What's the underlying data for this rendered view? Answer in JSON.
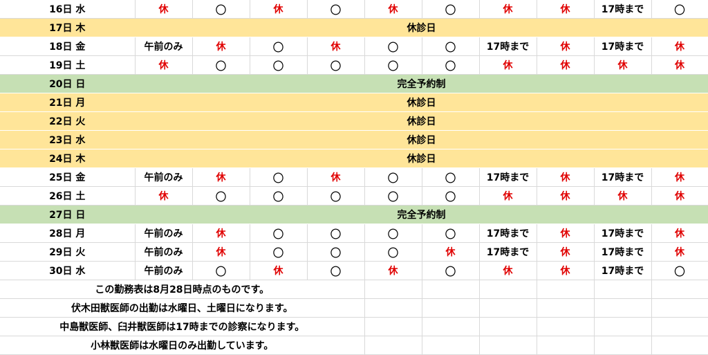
{
  "schedule": [
    {
      "date": "16日",
      "weekday": "水",
      "type": "normal",
      "cells": [
        "休",
        "〇",
        "休",
        "〇",
        "休",
        "〇",
        "休",
        "休",
        "17時まで",
        "〇"
      ]
    },
    {
      "date": "17日",
      "weekday": "木",
      "type": "holiday",
      "label": "休診日"
    },
    {
      "date": "18日",
      "weekday": "金",
      "type": "normal",
      "cells": [
        "午前のみ",
        "休",
        "〇",
        "休",
        "〇",
        "〇",
        "17時まで",
        "休",
        "17時まで",
        "休"
      ]
    },
    {
      "date": "19日",
      "weekday": "土",
      "type": "normal",
      "cells": [
        "休",
        "〇",
        "〇",
        "〇",
        "〇",
        "〇",
        "休",
        "休",
        "休",
        "休"
      ]
    },
    {
      "date": "20日",
      "weekday": "日",
      "type": "appointment",
      "label": "完全予約制"
    },
    {
      "date": "21日",
      "weekday": "月",
      "type": "holiday",
      "label": "休診日"
    },
    {
      "date": "22日",
      "weekday": "火",
      "type": "holiday",
      "label": "休診日"
    },
    {
      "date": "23日",
      "weekday": "水",
      "type": "holiday",
      "label": "休診日"
    },
    {
      "date": "24日",
      "weekday": "木",
      "type": "holiday",
      "label": "休診日"
    },
    {
      "date": "25日",
      "weekday": "金",
      "type": "normal",
      "cells": [
        "午前のみ",
        "休",
        "〇",
        "休",
        "〇",
        "〇",
        "17時まで",
        "休",
        "17時まで",
        "休"
      ]
    },
    {
      "date": "26日",
      "weekday": "土",
      "type": "normal",
      "cells": [
        "休",
        "〇",
        "〇",
        "〇",
        "〇",
        "〇",
        "休",
        "休",
        "休",
        "休"
      ]
    },
    {
      "date": "27日",
      "weekday": "日",
      "type": "appointment",
      "label": "完全予約制"
    },
    {
      "date": "28日",
      "weekday": "月",
      "type": "normal",
      "cells": [
        "午前のみ",
        "休",
        "〇",
        "〇",
        "〇",
        "〇",
        "17時まで",
        "休",
        "17時まで",
        "休"
      ]
    },
    {
      "date": "29日",
      "weekday": "火",
      "type": "normal",
      "cells": [
        "午前のみ",
        "休",
        "〇",
        "〇",
        "〇",
        "休",
        "17時まで",
        "休",
        "17時まで",
        "休"
      ]
    },
    {
      "date": "30日",
      "weekday": "水",
      "type": "normal",
      "cells": [
        "午前のみ",
        "〇",
        "休",
        "〇",
        "休",
        "〇",
        "休",
        "休",
        "17時まで",
        "〇"
      ]
    }
  ],
  "notes": [
    "この勤務表は8月28日時点のものです。",
    "伏木田獣医師の出勤は水曜日、土曜日になります。",
    "中島獣医師、臼井獣医師は17時までの診察になります。",
    "小林獣医師は水曜日のみ出勤しています。"
  ],
  "colors": {
    "holiday_fill": "#ffe599",
    "appointment_fill": "#c6e0b4",
    "off_text": "#e00000",
    "grid": "#d9d9d9"
  }
}
